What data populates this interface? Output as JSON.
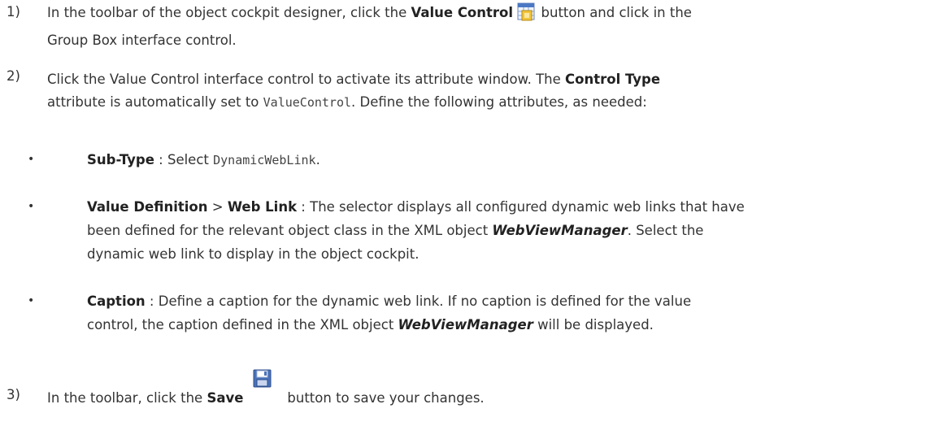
{
  "steps": [
    {
      "num": "1)",
      "t1": "In the toolbar of the object cockpit designer, click the ",
      "b1": "Value Control",
      "icon": "value-control-icon",
      "t2": " button and click in the",
      "line2": "Group Box interface control."
    },
    {
      "num": "2)",
      "t1": "Click the Value Control interface control to activate its attribute window. The ",
      "b1": "Control Type",
      "t2": "attribute is automatically set to ",
      "code": "ValueControl",
      "t3": ". Define the following attributes, as needed:"
    },
    {
      "num": "3)",
      "t1": "In the toolbar, click the ",
      "b1": "Save",
      "icon": "save-icon",
      "t2": "button to save your changes."
    }
  ],
  "bullets": [
    {
      "dot": "•",
      "b1": "Sub-Type",
      "t1": " : Select ",
      "code": "DynamicWebLink",
      "t2": "."
    },
    {
      "dot": "•",
      "b1": "Value Definition",
      "sep": " > ",
      "b2": "Web Link",
      "t1": " : The selector displays all configured dynamic web links that have",
      "t2": "been defined for the relevant object class in the XML object ",
      "b3": "WebViewManager",
      "t3": ". Select the",
      "t4": "dynamic web link to display in the object cockpit."
    },
    {
      "dot": "•",
      "b1": "Caption",
      "t1": " : Define a caption for the dynamic web link. If no caption is defined for the value",
      "t2": "control, the caption defined in the XML object ",
      "b2": "WebViewManager",
      "t3": " will be displayed."
    }
  ]
}
